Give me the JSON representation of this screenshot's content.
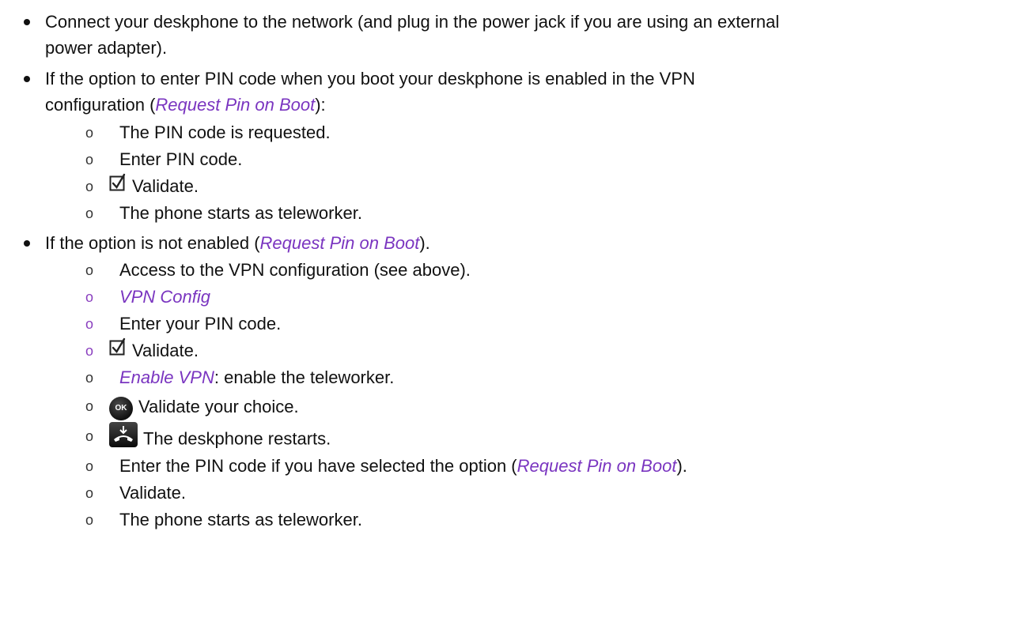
{
  "items": {
    "b1_line1": "Connect your deskphone to the network (and plug in the power jack if you are using an external",
    "b1_line2": "power adapter).",
    "b2_line1": "If the option to enter PIN code when you boot your deskphone is enabled in the VPN",
    "b2_line2_prefix": "configuration (",
    "b2_line2_em": "Request Pin on Boot",
    "b2_line2_suffix": "):",
    "b2_sub1": "The PIN code is requested.",
    "b2_sub2": "Enter PIN code.",
    "b2_sub3": "Validate.",
    "b2_sub4": "The phone starts as teleworker.",
    "b3_prefix": "If the option is not enabled (",
    "b3_em": "Request Pin on Boot",
    "b3_suffix": ").",
    "b3_sub1": "Access to the VPN configuration (see above).",
    "b3_sub2_em": "VPN Config",
    "b3_sub3": "Enter your PIN code.",
    "b3_sub4": "Validate.",
    "b3_sub5_em": "Enable VPN",
    "b3_sub5_suffix": ": enable the teleworker.",
    "b3_sub6": "Validate your choice.",
    "b3_sub7": "The deskphone restarts.",
    "b3_sub8_prefix": "Enter the PIN code if you have selected the option (",
    "b3_sub8_em": "Request Pin on Boot",
    "b3_sub8_suffix": ").",
    "b3_sub9": "Validate.",
    "b3_sub10": "The phone starts as teleworker."
  },
  "markers": {
    "sub_bullet": "o",
    "ok_key_label": "OK"
  },
  "icons": {
    "validate": "checkbox-checked-icon",
    "ok": "ok-key-icon",
    "hangup": "hangup-key-icon"
  },
  "colors": {
    "text": "#111111",
    "emphasis": "#7a35c0",
    "marker_purple": "#8a3fbf"
  }
}
